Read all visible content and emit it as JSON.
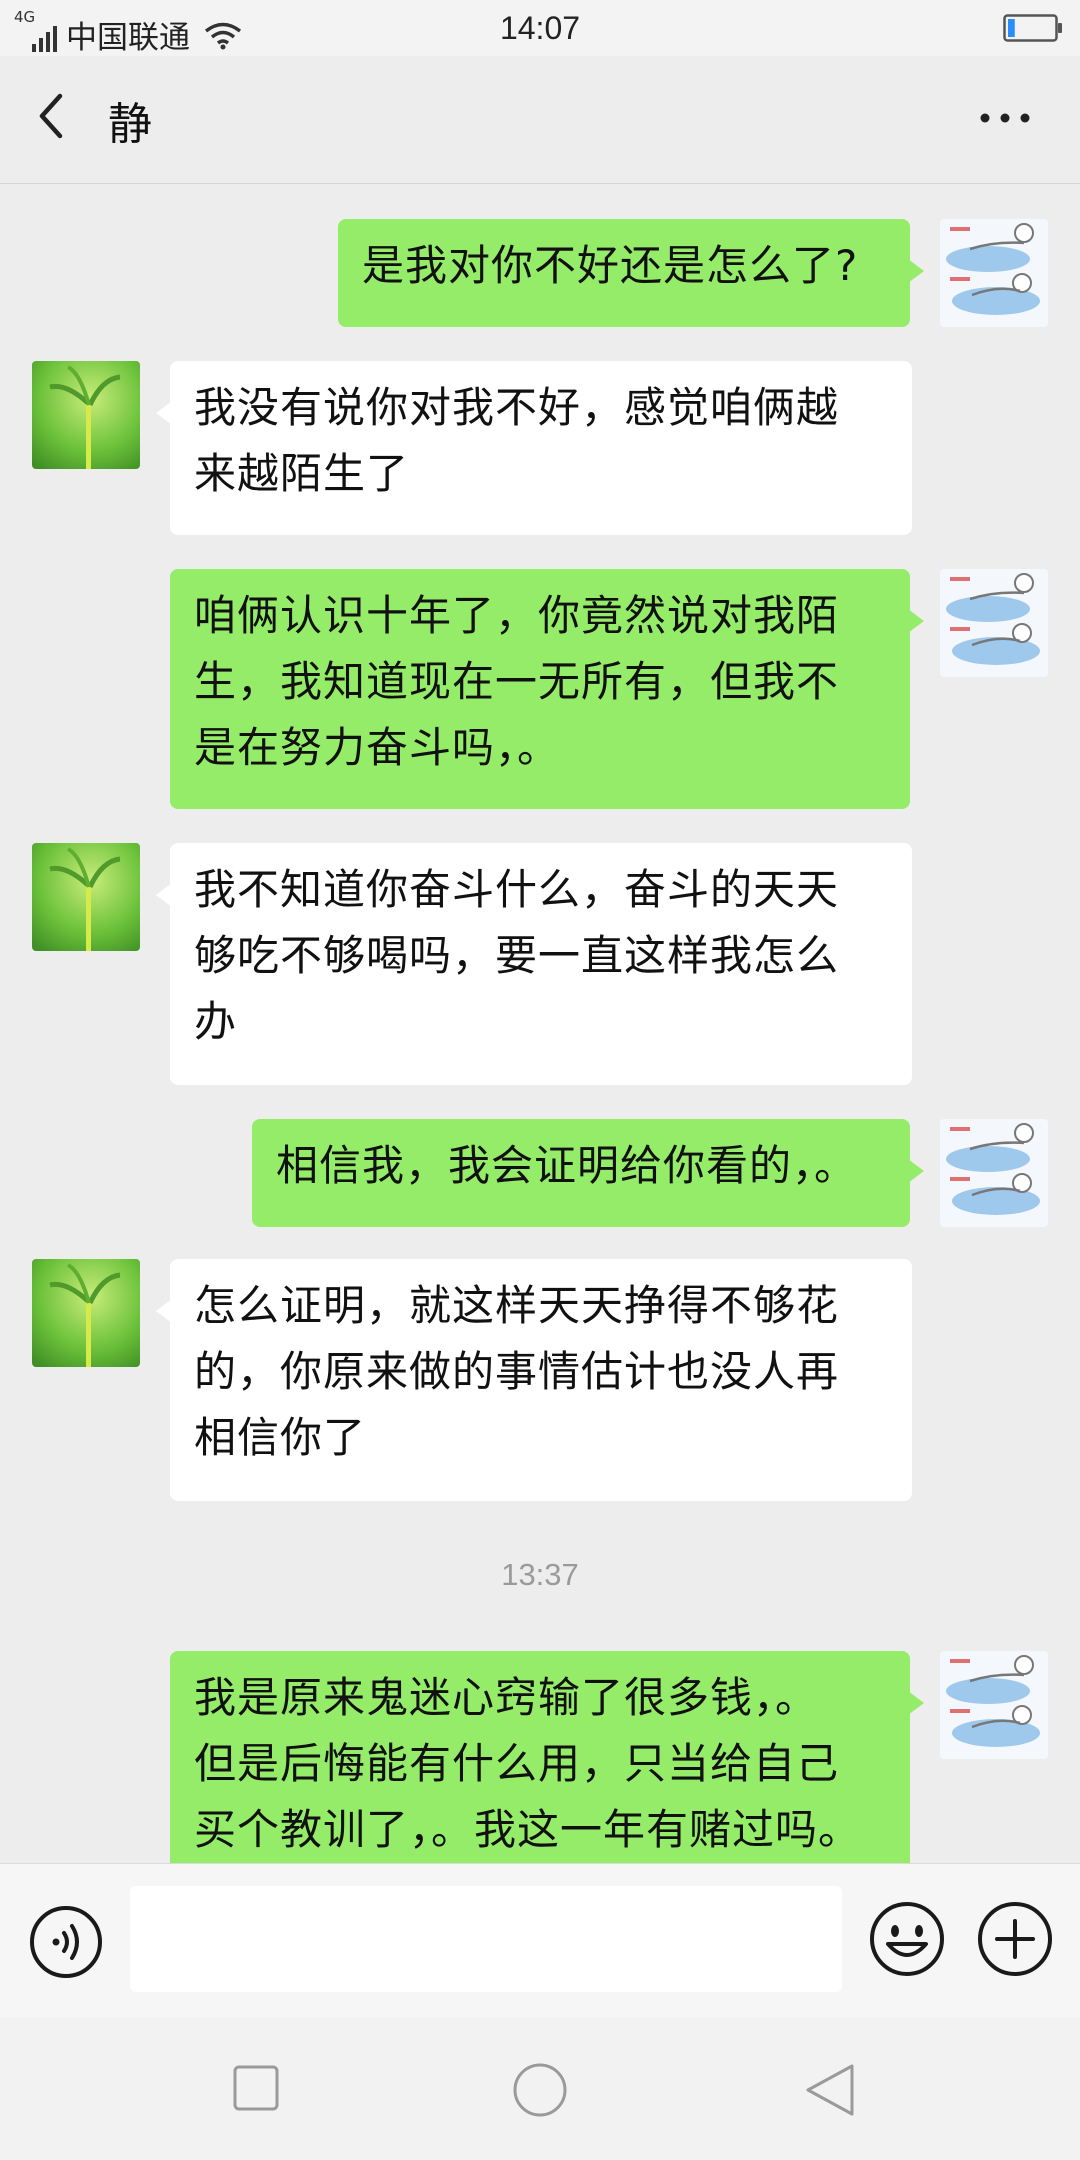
{
  "status_bar": {
    "network": "4G",
    "carrier": "中国联通",
    "time": "14:07",
    "battery_level": 0.15
  },
  "header": {
    "title": "静"
  },
  "messages": [
    {
      "sender": "me",
      "lines": [
        "是我对你不好还是怎么了?"
      ]
    },
    {
      "sender": "them",
      "lines": [
        "我没有说你对我不好，感觉咱俩越",
        "来越陌生了"
      ]
    },
    {
      "sender": "me",
      "lines": [
        "咱俩认识十年了，你竟然说对我陌",
        "生，我知道现在一无所有，但我不",
        "是在努力奋斗吗，。"
      ]
    },
    {
      "sender": "them",
      "lines": [
        "我不知道你奋斗什么，奋斗的天天",
        "够吃不够喝吗，要一直这样我怎么",
        "办"
      ]
    },
    {
      "sender": "me",
      "lines": [
        "相信我，我会证明给你看的，。"
      ]
    },
    {
      "sender": "them",
      "lines": [
        "怎么证明，就这样天天挣得不够花",
        "的，你原来做的事情估计也没人再",
        "相信你了"
      ]
    },
    {
      "sender": "me",
      "lines": [
        "我是原来鬼迷心窍输了很多钱，。",
        "但是后悔能有什么用，只当给自己",
        "买个教训了，。我这一年有赌过吗。"
      ]
    }
  ],
  "timestamp": "13:37",
  "input": {
    "value": "",
    "placeholder": ""
  },
  "icons": {
    "back": "chevron-left-icon",
    "more": "more-dots-icon",
    "voice": "voice-icon",
    "emoji": "emoji-icon",
    "plus": "plus-icon"
  },
  "colors": {
    "my_bubble": "#95ec69",
    "their_bubble": "#ffffff",
    "background": "#ededed"
  }
}
